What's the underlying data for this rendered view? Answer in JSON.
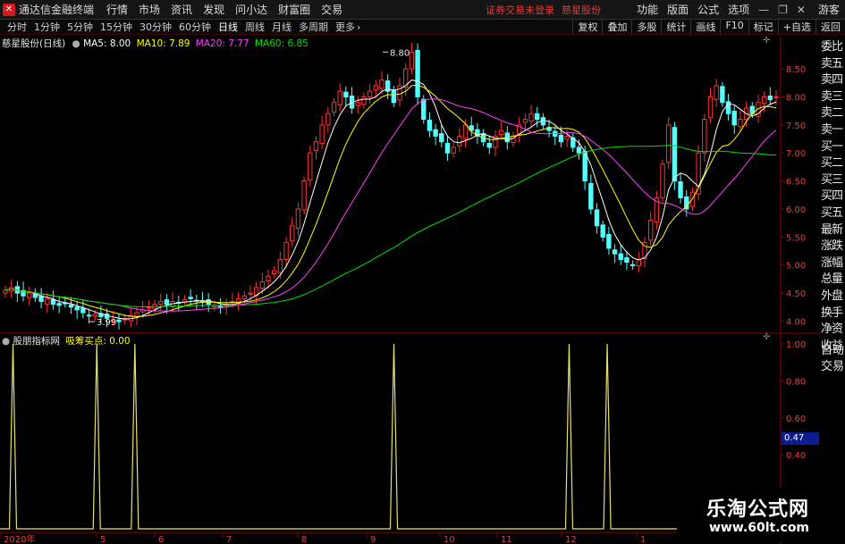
{
  "menubar": {
    "app_name": "通达信金融终端",
    "menus": [
      "行情",
      "市场",
      "资讯",
      "发现",
      "问小达",
      "财富圈",
      "交易"
    ],
    "notice": "证券交易未登录",
    "stock_link": "慈星股份",
    "right_menus": [
      "功能",
      "版面",
      "公式",
      "选项"
    ],
    "guest": "游客"
  },
  "toolbar": {
    "periods": [
      "分时",
      "1分钟",
      "5分钟",
      "15分钟",
      "30分钟",
      "60分钟",
      "日线",
      "周线",
      "月线",
      "多周期",
      "更多"
    ],
    "active_period": "日线",
    "right_buttons": [
      "复权",
      "叠加",
      "多股",
      "统计",
      "画线",
      "F10",
      "标记",
      "+自选",
      "返回"
    ]
  },
  "chart_info": {
    "title": "慈星股份(日线)",
    "ma5": "MA5: 8.00",
    "ma10": "MA10: 7.89",
    "ma20": "MA20: 7.77",
    "ma60": "MA60: 6.85",
    "colors": {
      "ma5": "#ffffff",
      "ma10": "#ffff00",
      "ma20": "#ff40ff",
      "ma60": "#00e000"
    }
  },
  "indicator_info": {
    "name": "股朋指标网",
    "param": "吸筹买点: 0.00"
  },
  "price_axis": [
    "8.50",
    "8.00",
    "7.50",
    "7.00",
    "6.50",
    "6.00",
    "5.50",
    "5.00",
    "4.50",
    "4.00"
  ],
  "indicator_axis": [
    "1.00",
    "0.80",
    "0.60",
    "0.47",
    "0.40"
  ],
  "indicator_value": "0.47",
  "date_axis": [
    "2020年",
    "5",
    "6",
    "7",
    "8",
    "9",
    "10",
    "11",
    "12",
    "1"
  ],
  "annotations": {
    "high": "8.80",
    "low": "3.99"
  },
  "side_panel": [
    "委比",
    "卖五",
    "卖四",
    "卖三",
    "卖二",
    "卖一",
    "买一",
    "买二",
    "买三",
    "买四",
    "买五",
    "最新",
    "涨跌",
    "涨幅",
    "总量",
    "外盘",
    "换手",
    "净资",
    "收益"
  ],
  "auto_trade": [
    "自动",
    "交易"
  ],
  "watermark": {
    "title": "乐淘公式网",
    "url": "www.60lt.com"
  },
  "chart_data": {
    "type": "candlestick",
    "title": "慈星股份(日线)",
    "ylim": [
      3.8,
      8.9
    ],
    "x_months": [
      "2020年",
      "5",
      "6",
      "7",
      "8",
      "9",
      "10",
      "11",
      "12",
      "1"
    ],
    "closes": [
      4.55,
      4.6,
      4.5,
      4.45,
      4.5,
      4.42,
      4.35,
      4.4,
      4.3,
      4.28,
      4.32,
      4.25,
      4.2,
      4.15,
      4.1,
      4.12,
      4.08,
      4.05,
      4.02,
      3.99,
      4.05,
      4.1,
      4.15,
      4.2,
      4.25,
      4.3,
      4.35,
      4.3,
      4.35,
      4.32,
      4.38,
      4.4,
      4.36,
      4.35,
      4.3,
      4.28,
      4.25,
      4.3,
      4.35,
      4.4,
      4.45,
      4.5,
      4.6,
      4.7,
      4.8,
      4.9,
      5.1,
      5.4,
      5.7,
      6.0,
      6.5,
      7.0,
      7.2,
      7.5,
      7.7,
      7.9,
      8.1,
      8.0,
      7.8,
      7.9,
      8.0,
      8.1,
      8.2,
      8.3,
      8.1,
      7.9,
      8.2,
      8.5,
      8.8,
      8.0,
      7.6,
      7.4,
      7.3,
      7.2,
      7.0,
      7.1,
      7.3,
      7.5,
      7.4,
      7.3,
      7.2,
      7.1,
      7.3,
      7.4,
      7.2,
      7.3,
      7.5,
      7.6,
      7.7,
      7.6,
      7.5,
      7.4,
      7.3,
      7.2,
      7.3,
      7.1,
      7.0,
      6.5,
      6.0,
      5.7,
      5.5,
      5.3,
      5.2,
      5.1,
      5.05,
      5.0,
      5.1,
      5.4,
      5.8,
      6.2,
      6.8,
      7.5,
      6.5,
      6.2,
      6.0,
      6.3,
      7.0,
      7.6,
      8.0,
      8.2,
      7.9,
      7.7,
      7.5,
      7.6,
      7.8,
      7.7,
      7.9,
      8.0,
      7.95,
      8.0
    ],
    "ma60_end": 6.85,
    "indicator_peaks": [
      0.01,
      0.12,
      0.17,
      0.51,
      0.74,
      0.79
    ]
  }
}
